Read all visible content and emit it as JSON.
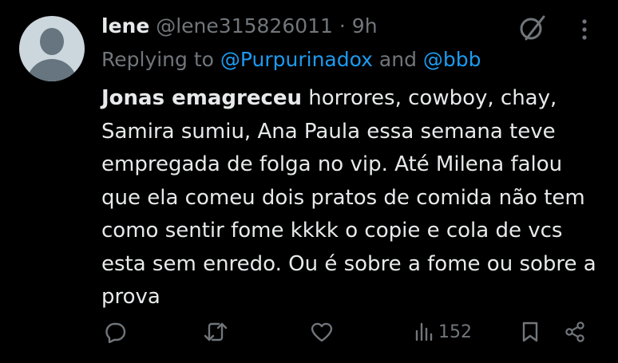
{
  "tweet": {
    "author_name": "lene",
    "handle": "@lene315826011",
    "separator": " · ",
    "time": "9h",
    "replying_prefix": "Replying to ",
    "replying_mention_1": "@Purpurinadox",
    "replying_and": " and ",
    "replying_mention_2": "@bbb",
    "text_bold": "Jonas emagreceu",
    "text_rest": " horrores, cowboy, chay, Samira sumiu, Ana Paula essa semana teve empregada de folga no vip. Até Milena falou que ela comeu dois pratos de comida não tem como sentir fome kkkk o copie e cola de vcs esta sem enredo. Ou é sobre a fome ou sobre a prova"
  },
  "actions": {
    "views_count": "152"
  },
  "icons": {
    "grok": "grok-icon",
    "more": "more-icon",
    "reply": "reply-icon",
    "retweet": "retweet-icon",
    "like": "like-icon",
    "views": "views-icon",
    "bookmark": "bookmark-icon",
    "share": "share-icon"
  },
  "colors": {
    "background": "#000000",
    "text": "#e7e9ea",
    "muted": "#71767b",
    "link": "#1d9bf0",
    "avatar_bg": "#ccd6dd",
    "avatar_fg": "#66757f"
  }
}
